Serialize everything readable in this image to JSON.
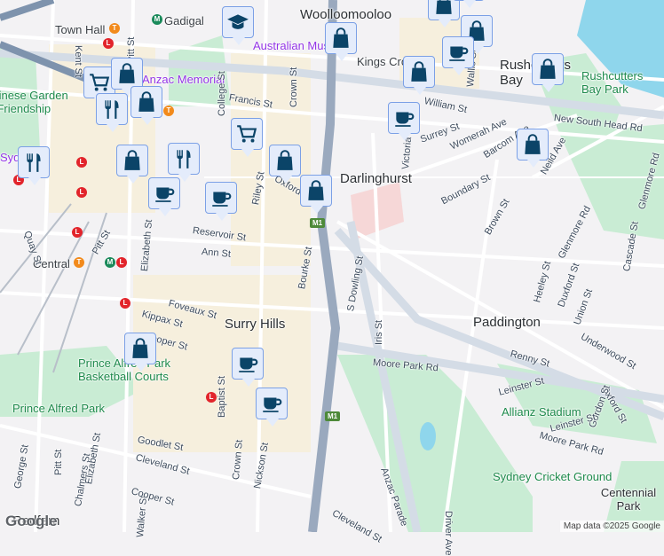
{
  "suburbs": {
    "woolloomooloo": "Woolloomooloo",
    "darlinghurst": "Darlinghurst",
    "surry_hills": "Surry Hills",
    "paddington": "Paddington",
    "redfern": "Redfern",
    "rushcutters": "Rushcutters Bay",
    "kings_cross": "Kings Cross"
  },
  "pois": {
    "gadigal": "Gadigal",
    "town_hall": "Town Hall",
    "australian_museum": "Australian Museum",
    "memorial": "Anzac Memorial",
    "central": "Central",
    "chinese_garden": "Chinese Garden of Friendship",
    "rushcutters_park": "Rushcutters Bay Park",
    "prince_alfred_courts": "Prince Alfred Park Basketball Courts",
    "prince_alfred_park": "Prince Alfred Park",
    "allianz": "Allianz Stadium",
    "scg": "Sydney Cricket Ground",
    "centennial": "Centennial Park",
    "sydney": "Sydney"
  },
  "streets": [
    "Kent St",
    "Pitt St",
    "College St",
    "Francis St",
    "Crown St",
    "William St",
    "New South Head Rd",
    "Surrey St",
    "Womerah Ave",
    "Barcom Ave",
    "Neild Ave",
    "Boundary St",
    "Brown St",
    "Glenmore Rd",
    "Glenmore Rd",
    "Cascade St",
    "Riley St",
    "Reservoir St",
    "Ann St",
    "Pitt St",
    "Quay St",
    "Elizabeth St",
    "Bourke St",
    "S Dowling St",
    "Foveaux St",
    "Kippax St",
    "Cooper St",
    "Iris St",
    "Heeley St",
    "Duxford St",
    "Union St",
    "Underwood St",
    "Renny St",
    "Moore Park Rd",
    "Leinster St",
    "Oxford St",
    "Gordon St",
    "Leinster St",
    "Moore Park Rd",
    "Anzac Parade",
    "Driver Ave",
    "Goodlet St",
    "Cleveland St",
    "Crown St",
    "Nickson St",
    "Baptist St",
    "Pitt St",
    "George St",
    "Chalmers St",
    "Elizabeth St",
    "Walker St",
    "Cooper St",
    "Cleveland St",
    "Victoria St",
    "Wallis St",
    "Oxford St"
  ],
  "shields": {
    "m1": "M1"
  },
  "transit": {
    "L": "L",
    "T": "T",
    "M": "M"
  },
  "markers": [
    "school",
    "shopping-bag",
    "shopping-bag",
    "shopping-bag",
    "shopping-bag",
    "shopping-bag",
    "cafe",
    "shopping-bag",
    "shopping-bag",
    "cafe",
    "shopping-bag",
    "shopping-cart",
    "shopping-bag",
    "restaurant",
    "shopping-bag",
    "shopping-cart",
    "restaurant",
    "shopping-bag",
    "restaurant",
    "shopping-bag",
    "shopping-bag",
    "cafe",
    "cafe",
    "shopping-bag",
    "cafe",
    "cafe"
  ],
  "attribution": "Map data ©2025 Google",
  "logo": "Google",
  "colors": {
    "marker_bg": "#e4ecfb",
    "marker_icon": "#0b4468",
    "park": "#c9ecd4",
    "water": "#8fd6ec",
    "motorway": "#9aa9be"
  }
}
